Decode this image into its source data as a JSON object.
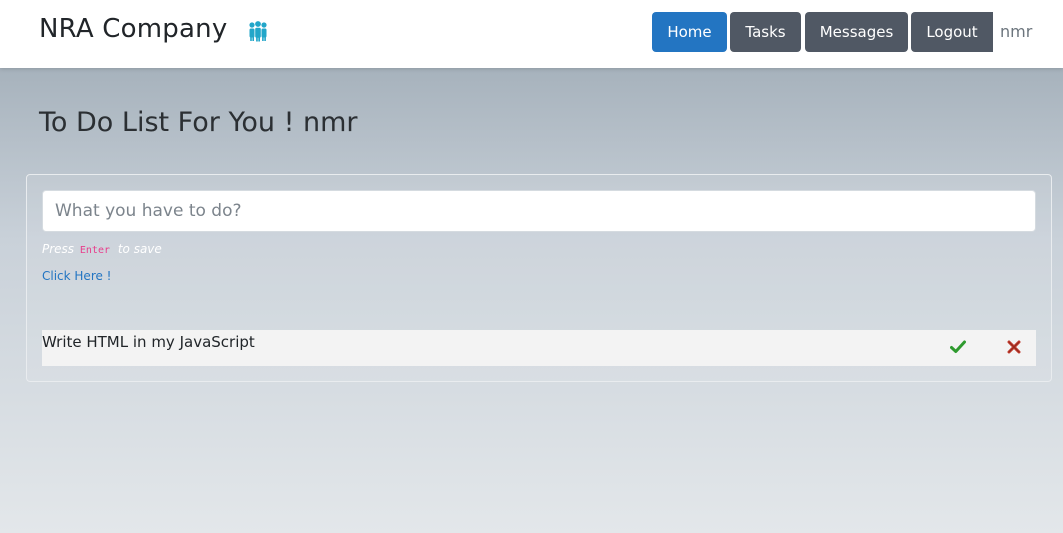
{
  "navbar": {
    "brand": "NRA Company",
    "brand_icon": "people-group-icon",
    "buttons": {
      "home": "Home",
      "tasks": "Tasks",
      "messages": "Messages",
      "logout": "Logout"
    },
    "user": "nmr"
  },
  "main": {
    "title": "To Do List For You ! nmr",
    "input_placeholder": "What you have to do?",
    "hint_prefix": "Press",
    "hint_key": "Enter",
    "hint_suffix": "to save",
    "link": "Click Here !",
    "todos": [
      {
        "text": "Write HTML in my JavaScript",
        "done_icon": "check-icon",
        "delete_icon": "close-icon"
      }
    ]
  },
  "colors": {
    "primary": "#2375c2",
    "secondary": "#505864",
    "check": "#2e9a2e",
    "delete": "#c0392b"
  }
}
